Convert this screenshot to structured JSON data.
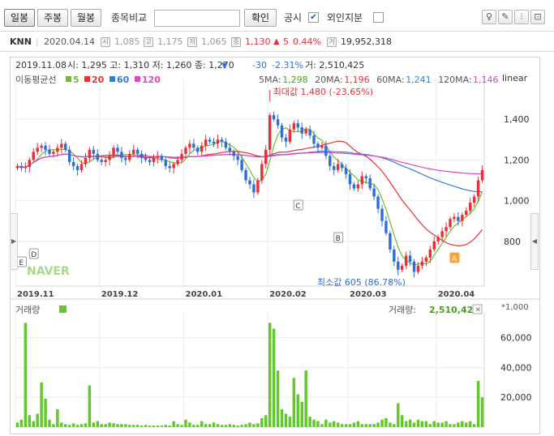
{
  "toolbar": {
    "tabs": [
      "일봉",
      "주봉",
      "월봉"
    ],
    "compare_label": "종목비교",
    "confirm_label": "확인",
    "short_label": "공시",
    "short_checked": "✔",
    "foreign_label": "외인지분",
    "icons": [
      "bulb-icon",
      "eraser-icon",
      "candle-icon",
      "scale-icon"
    ]
  },
  "info": {
    "ticker": "KNN",
    "date": "2020.04.14",
    "open_icon": "시",
    "open": "1,085",
    "high_icon": "고",
    "high": "1,175",
    "low_icon": "저",
    "low": "1,065",
    "close_icon": "종",
    "close": "1,130",
    "change_arrow": "▲",
    "change": "5",
    "change_pct": "0.44%",
    "volume_icon": "거",
    "volume": "19,952,318"
  },
  "legend": {
    "ohlc_date": "2019.11.08",
    "ohlc": "시: 1,295  고: 1,310  저: 1,260  종: 1,270",
    "ohlc_arrow": "▼",
    "ohlc_change": "-30",
    "ohlc_pct": "-2.31%",
    "ohlc_vol": "거: 2,510,425",
    "ma_title": "이동평균선",
    "ma_items": [
      {
        "label": "5",
        "color": "#6cbf2e"
      },
      {
        "label": "20",
        "color": "#e8303a"
      },
      {
        "label": "60",
        "color": "#2f7fd6"
      },
      {
        "label": "120",
        "color": "#e048c0"
      }
    ],
    "ma_values": [
      {
        "label": "5MA:",
        "value": "1,298",
        "color": "#4aa01e"
      },
      {
        "label": "20MA:",
        "value": "1,196",
        "color": "#e8303a"
      },
      {
        "label": "60MA:",
        "value": "1,241",
        "color": "#2f7fd6"
      },
      {
        "label": "120MA:",
        "value": "1,146",
        "color": "#d840b0"
      }
    ],
    "scale_label": "linear",
    "max_label": "최대값 1,480 (-23.65%)",
    "min_label": "최소값 605 (86.78%)",
    "markers": [
      "E",
      "D",
      "C",
      "B",
      "A"
    ],
    "watermark": "NAVER"
  },
  "volume_panel": {
    "title": "거래량",
    "value_label": "거래량:",
    "value": "2,510,425",
    "unit_label": "*1,000",
    "close_icon": "✕"
  },
  "colors": {
    "up": "#e8303a",
    "down": "#2f6fd6",
    "ma5": "#6cbf2e",
    "ma20": "#e8303a",
    "ma60": "#2f7fd6",
    "ma120": "#e048c0",
    "volume_bar": "#62c82c"
  },
  "chart_data": {
    "type": "candlestick",
    "price_axis": {
      "scale": "linear",
      "ticks": [
        800,
        1000,
        1200,
        1400
      ],
      "ylim": [
        580,
        1560
      ]
    },
    "volume_axis": {
      "ticks": [
        20000,
        40000,
        60000
      ],
      "ylim": [
        0,
        74000
      ],
      "unit": "*1,000"
    },
    "x_ticks": [
      {
        "label": "2019.11",
        "index": 0
      },
      {
        "label": "2019.12",
        "index": 21
      },
      {
        "label": "2020.01",
        "index": 42
      },
      {
        "label": "2020.02",
        "index": 63
      },
      {
        "label": "2020.03",
        "index": 83
      },
      {
        "label": "2020.04",
        "index": 105
      }
    ],
    "close": [
      1170,
      1160,
      1165,
      1200,
      1240,
      1260,
      1270,
      1250,
      1230,
      1240,
      1260,
      1280,
      1250,
      1190,
      1170,
      1150,
      1180,
      1210,
      1250,
      1230,
      1200,
      1190,
      1200,
      1220,
      1260,
      1240,
      1210,
      1200,
      1230,
      1250,
      1230,
      1210,
      1200,
      1190,
      1210,
      1220,
      1200,
      1170,
      1160,
      1180,
      1200,
      1230,
      1260,
      1280,
      1260,
      1240,
      1270,
      1300,
      1290,
      1280,
      1300,
      1290,
      1260,
      1240,
      1220,
      1200,
      1150,
      1100,
      1080,
      1040,
      1100,
      1180,
      1250,
      1420,
      1400,
      1370,
      1310,
      1290,
      1350,
      1380,
      1360,
      1330,
      1350,
      1320,
      1280,
      1260,
      1270,
      1220,
      1170,
      1150,
      1180,
      1160,
      1130,
      1080,
      1060,
      1080,
      1120,
      1110,
      1060,
      1020,
      960,
      900,
      840,
      760,
      700,
      660,
      680,
      730,
      700,
      650,
      680,
      700,
      720,
      760,
      800,
      820,
      850,
      870,
      910,
      920,
      900,
      930,
      950,
      990,
      1020,
      1100,
      1150
    ],
    "ma_periods": [
      5,
      20,
      60,
      120
    ],
    "max": {
      "value": 1480,
      "index": 63
    },
    "min": {
      "value": 605,
      "index": 93
    },
    "volume": [
      3000,
      5000,
      70000,
      8000,
      4000,
      9000,
      30000,
      19000,
      5000,
      2000,
      12000,
      3000,
      2000,
      1500,
      2500,
      1500,
      2000,
      2500,
      28000,
      3000,
      4000,
      2000,
      2000,
      3000,
      2500,
      2000,
      2000,
      2000,
      1500,
      1500,
      1500,
      1000,
      1500,
      1000,
      1000,
      1000,
      1000,
      1500,
      1000,
      4000,
      2000,
      1500,
      5000,
      3000,
      1500,
      1500,
      4000,
      2000,
      2000,
      3000,
      2000,
      1500,
      1500,
      2000,
      1500,
      1000,
      1500,
      2000,
      3000,
      2000,
      2500,
      6000,
      8000,
      70000,
      66000,
      38000,
      12000,
      9000,
      7000,
      33000,
      22000,
      17000,
      38000,
      7000,
      5000,
      4000,
      2000,
      5000,
      3000,
      4000,
      3000,
      2000,
      2000,
      2000,
      3000,
      4000,
      2000,
      2000,
      2000,
      2000,
      3000,
      5000,
      6000,
      3000,
      2000,
      16000,
      8000,
      4000,
      5000,
      3000,
      5000,
      4000,
      4000,
      2000,
      4000,
      3000,
      3000,
      4000,
      2000,
      2000,
      3000,
      4000,
      3000,
      4000,
      2000,
      31000,
      20000
    ]
  }
}
